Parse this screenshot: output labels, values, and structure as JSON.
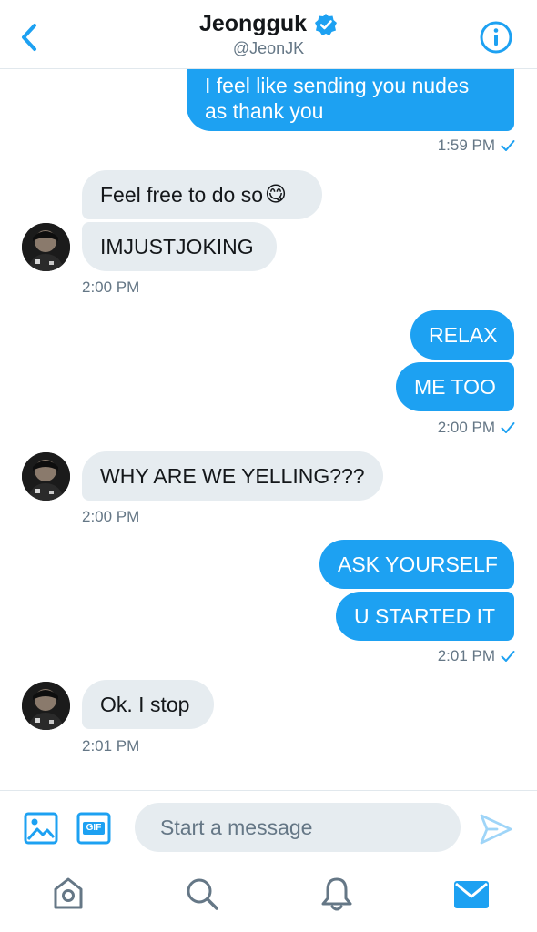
{
  "header": {
    "name": "Jeongguk",
    "handle": "@JeonJK"
  },
  "messages": [
    {
      "text_line1": "I feel like sending you nudes",
      "text_line2": "as thank you"
    },
    {
      "time": "1:59 PM"
    },
    {
      "text": "Feel free to do so",
      "emoji": "😋"
    },
    {
      "text": "IMJUSTJOKING"
    },
    {
      "time": "2:00 PM"
    },
    {
      "text": "RELAX"
    },
    {
      "text": "ME TOO"
    },
    {
      "time": "2:00 PM"
    },
    {
      "text": "WHY ARE WE YELLING???"
    },
    {
      "time": "2:00 PM"
    },
    {
      "text": "ASK YOURSELF"
    },
    {
      "text": "U STARTED IT"
    },
    {
      "time": "2:01 PM"
    },
    {
      "text": "Ok. I stop"
    },
    {
      "time": "2:01 PM"
    }
  ],
  "composer": {
    "placeholder": "Start a message",
    "gif_label": "GIF"
  },
  "colors": {
    "accent": "#1da1f2",
    "incoming_bubble": "#e6ecf0"
  }
}
